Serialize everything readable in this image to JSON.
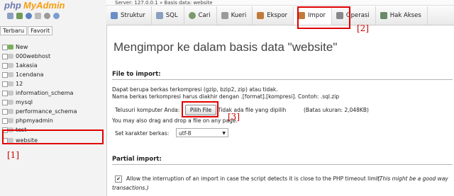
{
  "sidebar": {
    "logo_part1": "php",
    "logo_part2": "MyAdmin",
    "tabs": [
      "Terbaru",
      "Favorit"
    ],
    "items": [
      {
        "label": "New"
      },
      {
        "label": "000webhost"
      },
      {
        "label": "1akasia"
      },
      {
        "label": "1cendana"
      },
      {
        "label": "12"
      },
      {
        "label": "information_schema"
      },
      {
        "label": "mysql"
      },
      {
        "label": "performance_schema"
      },
      {
        "label": "phpmyadmin"
      },
      {
        "label": "test"
      },
      {
        "label": "website"
      }
    ],
    "icons": [
      "home-icon",
      "exit-icon",
      "help-icon",
      "docs-icon",
      "settings-icon",
      "reload-icon"
    ]
  },
  "breadcrumb": "Server: 127.0.0.1 » Basis data: website",
  "menu": {
    "tabs": [
      {
        "label": "Struktur",
        "icon": "structure-icon",
        "color": "#6a8fc5"
      },
      {
        "label": "SQL",
        "icon": "sql-icon",
        "color": "#8aa0c0"
      },
      {
        "label": "Cari",
        "icon": "search-icon",
        "color": "#7a9a6a"
      },
      {
        "label": "Kueri",
        "icon": "query-icon",
        "color": "#9a9a9a"
      },
      {
        "label": "Ekspor",
        "icon": "export-icon",
        "color": "#c07a3a"
      },
      {
        "label": "Impor",
        "icon": "import-icon",
        "color": "#c07a3a"
      },
      {
        "label": "Operasi",
        "icon": "operations-icon",
        "color": "#888888"
      },
      {
        "label": "Hak Akses",
        "icon": "privileges-icon",
        "color": "#6a8a6a"
      }
    ],
    "active": "Impor"
  },
  "annotations": {
    "m1": "[1]",
    "m2": "[2]",
    "m3": "[3]"
  },
  "main": {
    "title": "Mengimpor ke dalam basis data \"website\"",
    "file_section": "File to import:",
    "desc1": "Dapat berupa berkas terkompresi (gzip, bzip2, zip) atau tidak.",
    "desc2": "Nama berkas terkompresi harus diakhir dengan .[format].[kompresi]. Contoh: .sql.zip",
    "browse_label": "Telusuri komputer Anda:",
    "choose_button": "Pilih File",
    "no_file": "Tidak ada file yang dipilih",
    "max_size": "(Batas ukuran: 2,048KB)",
    "drag_text": "You may also drag and drop a file on any page.",
    "charset_label": "Set karakter berkas:",
    "charset_value": "utf-8",
    "partial_section": "Partial import:",
    "allow_text": "Allow the interruption of an import in case the script detects it is close to the PHP timeout limit.",
    "allow_note": "(This might be a good way",
    "allow_note2": "transactions.)"
  },
  "colors": {
    "highlight": "#e00000",
    "logo_php": "#6c78af",
    "logo_my": "#f89c0e"
  }
}
